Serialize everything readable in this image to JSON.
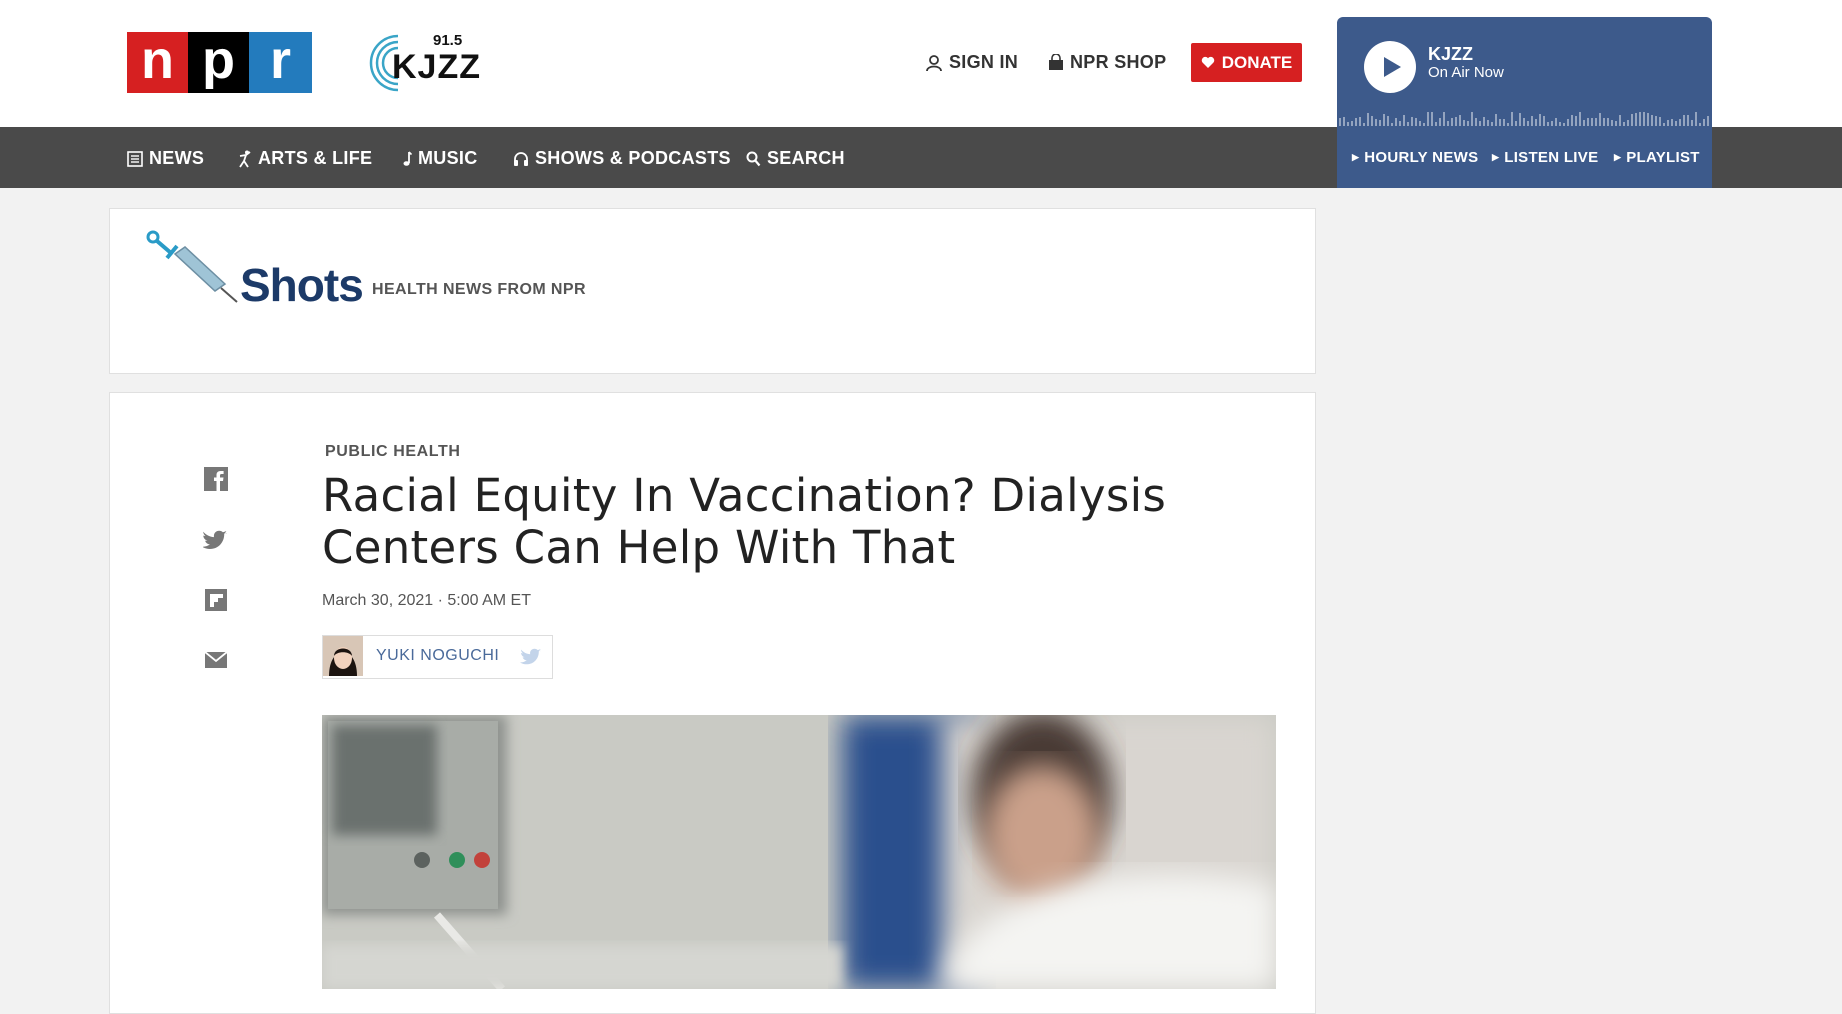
{
  "header": {
    "npr_logo": {
      "letters": [
        "n",
        "p",
        "r"
      ]
    },
    "station_logo": {
      "freq": "91.5",
      "name": "KJZZ"
    },
    "sign_in": "SIGN IN",
    "npr_shop": "NPR SHOP",
    "donate": "DONATE",
    "colors": {
      "npr_red": "#d62021",
      "npr_black": "#000000",
      "npr_blue": "#237bbd",
      "nav_bg": "#4a4a4a",
      "player_bg": "#3d5a8b"
    }
  },
  "nav": {
    "items": [
      {
        "label": "NEWS",
        "icon": "newspaper-icon"
      },
      {
        "label": "ARTS & LIFE",
        "icon": "dancer-icon"
      },
      {
        "label": "MUSIC",
        "icon": "music-note-icon"
      },
      {
        "label": "SHOWS & PODCASTS",
        "icon": "headphones-icon"
      },
      {
        "label": "SEARCH",
        "icon": "search-icon"
      }
    ]
  },
  "player": {
    "station": "KJZZ",
    "status": "On Air Now",
    "links": [
      "HOURLY NEWS",
      "LISTEN LIVE",
      "PLAYLIST"
    ]
  },
  "section": {
    "name": "Shots",
    "tagline": "HEALTH NEWS FROM NPR"
  },
  "article": {
    "slug": "PUBLIC HEALTH",
    "headline_line1": "Racial Equity In Vaccination? Dialysis",
    "headline_line2": "Centers Can Help With That",
    "dateline": "March 30, 2021 · 5:00 AM ET",
    "author": "YUKI NOGUCHI",
    "share_icons": [
      "facebook-icon",
      "twitter-icon",
      "flipboard-icon",
      "email-icon"
    ]
  }
}
